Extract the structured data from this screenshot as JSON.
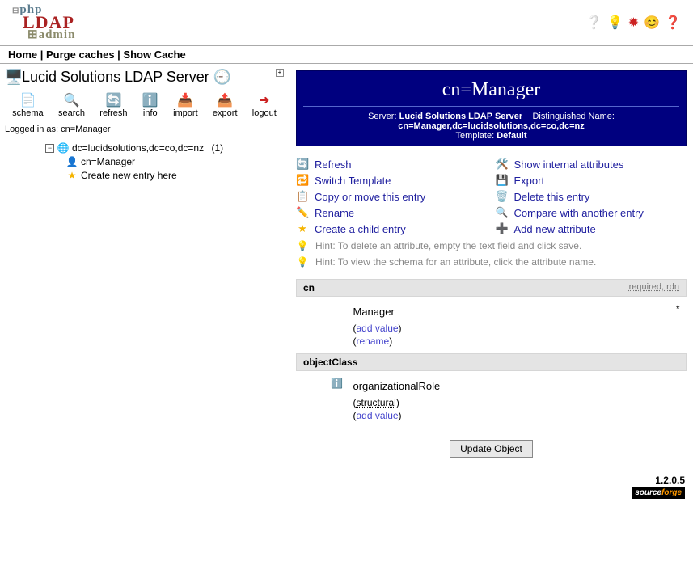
{
  "header_icons": [
    "help-icon",
    "lightbulb-icon",
    "bug-icon",
    "smiley-icon",
    "question-icon"
  ],
  "menu": {
    "home": "Home",
    "purge": "Purge caches",
    "show": "Show Cache"
  },
  "server_title": "Lucid Solutions LDAP Server",
  "toolbar": {
    "schema": "schema",
    "search": "search",
    "refresh": "refresh",
    "info": "info",
    "import": "import",
    "export": "export",
    "logout": "logout"
  },
  "logged_in_label": "Logged in as:",
  "logged_in_user": "cn=Manager",
  "tree": {
    "root": "dc=lucidsolutions,dc=co,dc=nz",
    "root_count": "(1)",
    "child": "cn=Manager",
    "create": "Create new entry here"
  },
  "entry": {
    "title": "cn=Manager",
    "server_label": "Server:",
    "server_value": "Lucid Solutions LDAP Server",
    "dn_label": "Distinguished Name:",
    "dn_value": "cn=Manager,dc=lucidsolutions,dc=co,dc=nz",
    "template_label": "Template:",
    "template_value": "Default"
  },
  "actions": {
    "refresh": "Refresh",
    "show_internal": "Show internal attributes",
    "switch_template": "Switch Template",
    "export": "Export",
    "copy_move": "Copy or move this entry",
    "delete": "Delete this entry",
    "rename": "Rename",
    "compare": "Compare with another entry",
    "create_child": "Create a child entry",
    "add_attr": "Add new attribute"
  },
  "hints": {
    "delete": "Hint: To delete an attribute, empty the text field and click save.",
    "schema": "Hint: To view the schema for an attribute, click the attribute name."
  },
  "attrs": {
    "cn": {
      "label": "cn",
      "meta": "required, rdn",
      "value": "Manager",
      "add": "add value",
      "rename": "rename"
    },
    "objectClass": {
      "label": "objectClass",
      "value": "organizationalRole",
      "structural": "structural",
      "add": "add value"
    }
  },
  "update_button": "Update Object",
  "version": "1.2.0.5"
}
